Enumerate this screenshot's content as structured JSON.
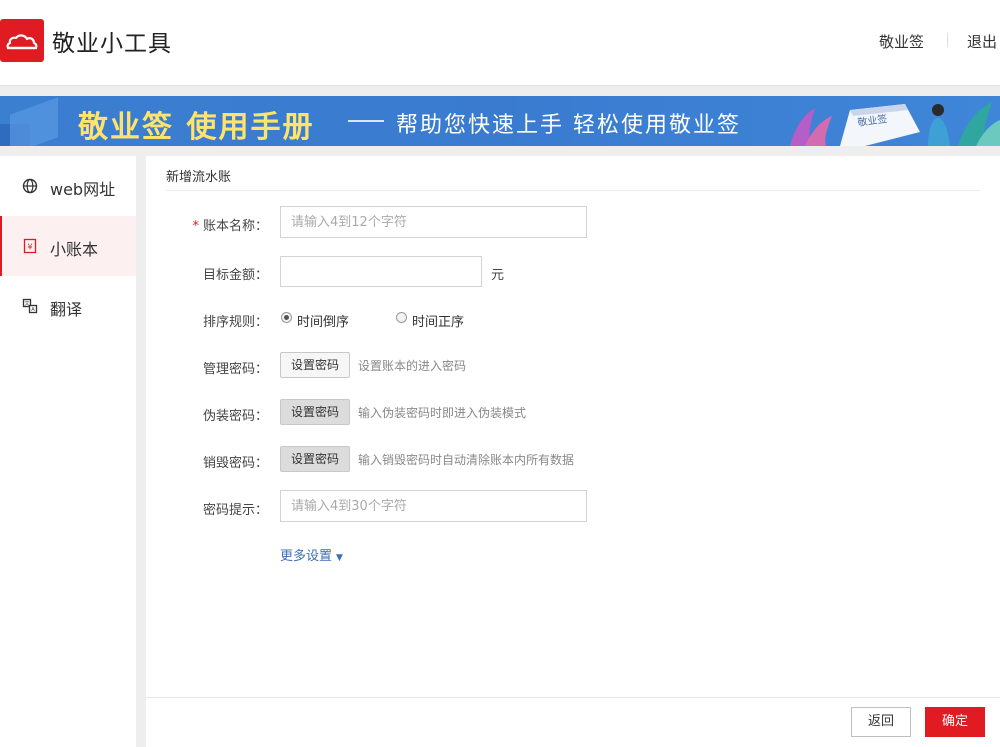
{
  "header": {
    "app_title": "敬业小工具",
    "logo_icon": "cloud-logo-icon",
    "nav": [
      {
        "label": "敬业签"
      },
      {
        "label": "退出"
      }
    ]
  },
  "banner": {
    "title": "敬业签 使用手册",
    "subtitle": "帮助您快速上手 轻松使用敬业签",
    "book_text": "敬业签"
  },
  "sidebar": {
    "items": [
      {
        "label": "web网址",
        "icon": "globe-icon"
      },
      {
        "label": "小账本",
        "icon": "ledger-icon",
        "active": true
      },
      {
        "label": "翻译",
        "icon": "translate-icon"
      }
    ]
  },
  "form": {
    "section_title": "新增流水账",
    "account_name": {
      "label": "账本名称：",
      "required": true,
      "placeholder": "请输入4到12个字符",
      "value": ""
    },
    "target_amount": {
      "label": "目标金额：",
      "value": "",
      "unit": "元"
    },
    "sort_rule": {
      "label": "排序规则：",
      "options": [
        {
          "label": "时间倒序",
          "checked": true
        },
        {
          "label": "时间正序",
          "checked": false
        }
      ]
    },
    "admin_password": {
      "label": "管理密码：",
      "button": "设置密码",
      "hint": "设置账本的进入密码"
    },
    "disguise_password": {
      "label": "伪装密码：",
      "button": "设置密码",
      "hint": "输入伪装密码时即进入伪装模式"
    },
    "destroy_password": {
      "label": "销毁密码：",
      "button": "设置密码",
      "hint": "输入销毁密码时自动清除账本内所有数据"
    },
    "password_hint": {
      "label": "密码提示：",
      "placeholder": "请输入4到30个字符",
      "value": ""
    },
    "more_settings": "更多设置"
  },
  "footer": {
    "back_label": "返回",
    "confirm_label": "确定"
  },
  "colors": {
    "brand": "#e01b22",
    "banner_blue": "#3b7fd1",
    "banner_title": "#ffe36a",
    "link": "#3b6fb6"
  }
}
